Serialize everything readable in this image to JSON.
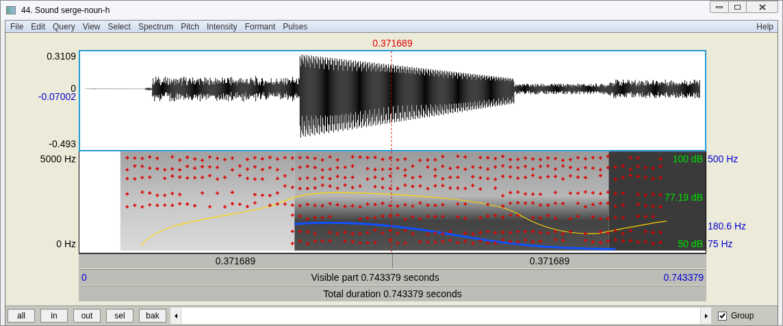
{
  "window": {
    "title": "44. Sound serge-noun-h"
  },
  "menu": [
    "File",
    "Edit",
    "Query",
    "View",
    "Select",
    "Spectrum",
    "Pitch",
    "Intensity",
    "Formant",
    "Pulses"
  ],
  "help": "Help",
  "cursor_time": "0.371689",
  "waveform_axis": {
    "max": "0.3109",
    "zero": "0",
    "cursor_value": "-0.07002",
    "min": "-0.493"
  },
  "spectrogram_axis": {
    "max": "5000 Hz",
    "min": "0 Hz"
  },
  "intensity_axis": {
    "max": "100 dB",
    "value": "77.19 dB",
    "min": "50 dB"
  },
  "pitch_axis": {
    "max": "500 Hz",
    "value": "180.6 Hz",
    "min": "75 Hz"
  },
  "selection_bar": [
    "0.371689",
    "0.371689"
  ],
  "visible_bar": {
    "start": "0",
    "label": "Visible part 0.743379 seconds",
    "end": "0.743379"
  },
  "total_bar": "Total duration 0.743379 seconds",
  "buttons": [
    "all",
    "in",
    "out",
    "sel",
    "bak"
  ],
  "group": {
    "label": "Group",
    "checked": true
  }
}
